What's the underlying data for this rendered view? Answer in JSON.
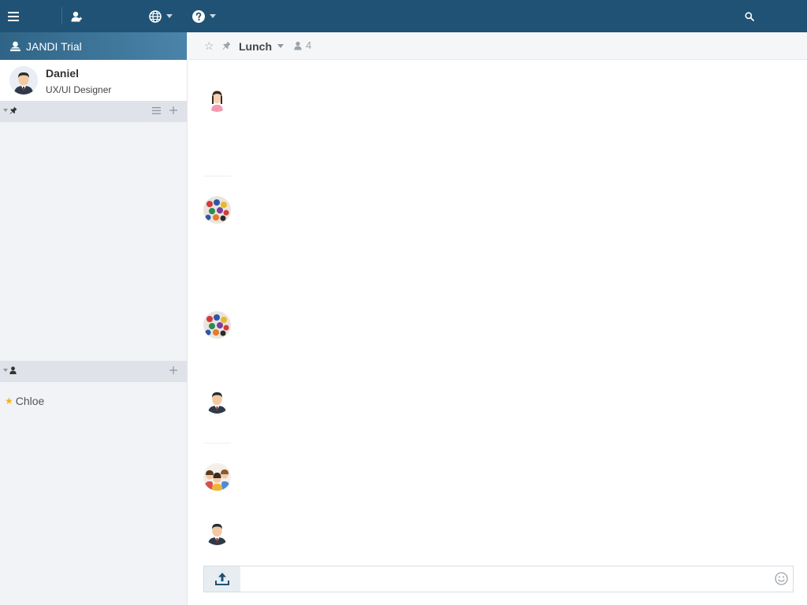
{
  "topbar": {
    "icons": [
      "menu-icon",
      "user-icon",
      "globe-icon",
      "help-icon",
      "search-icon"
    ],
    "color": "#1f5274"
  },
  "sidebar": {
    "team_name": "JANDI Trial",
    "profile": {
      "name": "Daniel",
      "role": "UX/UI Designer"
    },
    "topics_section": {
      "icons": [
        "pin-icon",
        "list-icon",
        "plus-icon"
      ]
    },
    "dm_section": {
      "icons": [
        "user-icon",
        "plus-icon"
      ]
    },
    "dm_items": [
      {
        "label": "Chloe",
        "starred": true
      }
    ]
  },
  "channel": {
    "name": "Lunch",
    "member_count": "4"
  },
  "composer": {
    "placeholder": "",
    "icons": [
      "upload-icon",
      "emoji-icon"
    ]
  }
}
